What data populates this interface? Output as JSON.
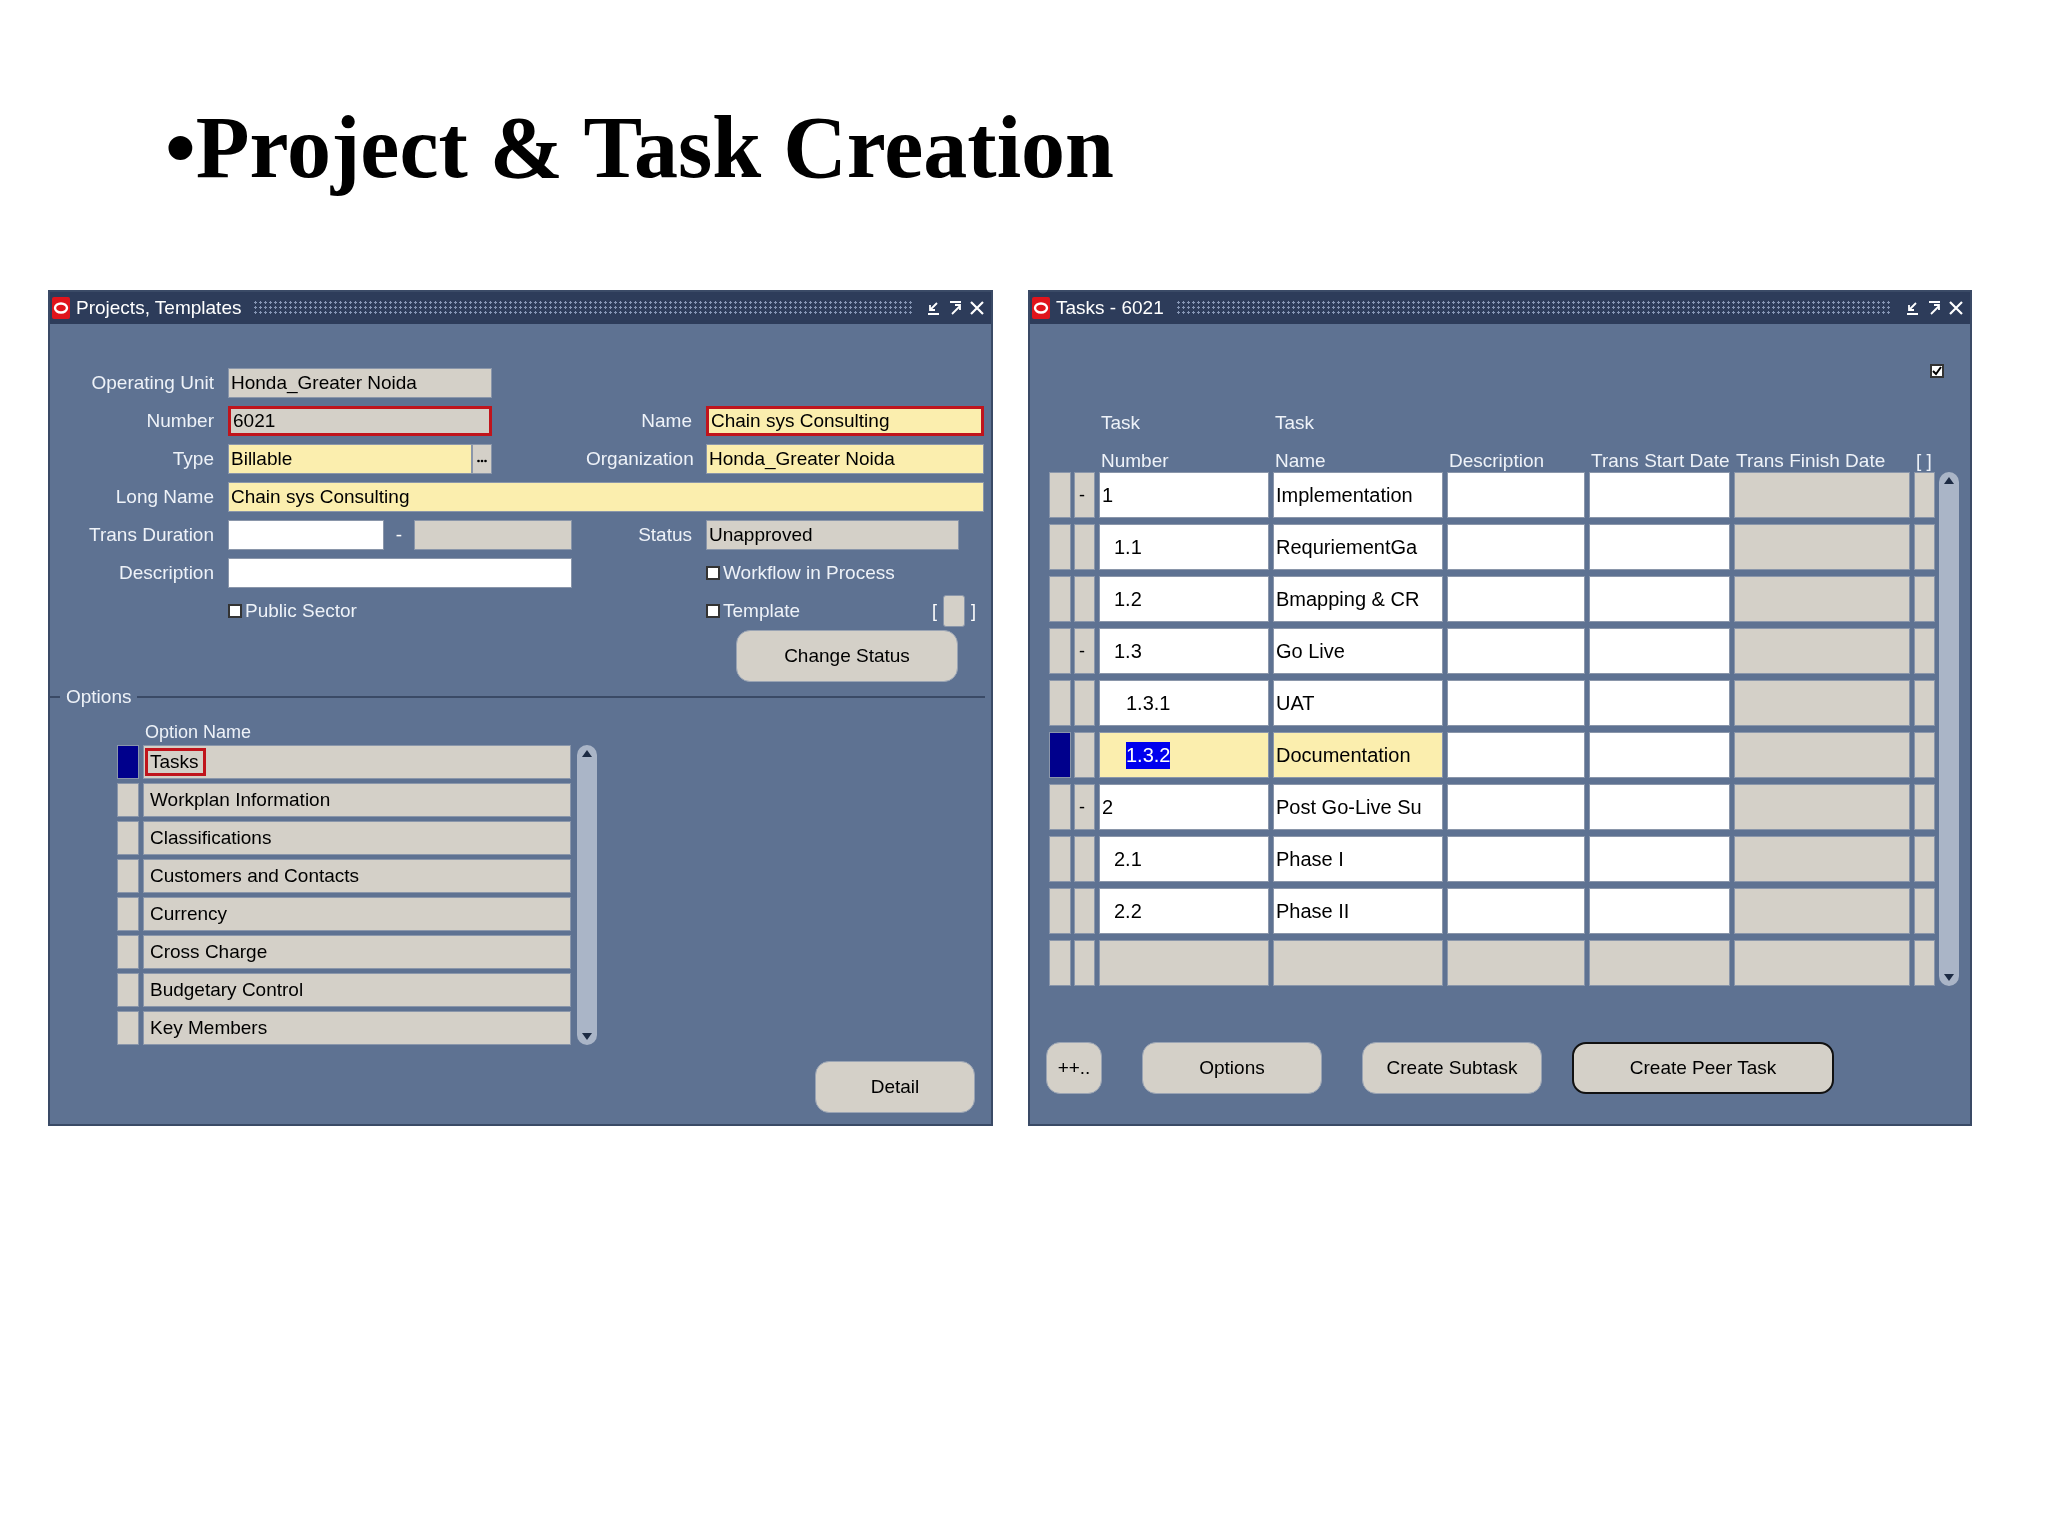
{
  "slide_title": "•Project & Task Creation",
  "projects_window": {
    "title": "Projects, Templates",
    "operating_unit": {
      "label": "Operating Unit",
      "value": "Honda_Greater Noida",
      "kind": "readonly",
      "highlighted": false
    },
    "number": {
      "label": "Number",
      "value": "6021",
      "kind": "readonly",
      "highlighted": true
    },
    "name": {
      "label": "Name",
      "value": "Chain sys Consulting",
      "kind": "required",
      "highlighted": true
    },
    "type": {
      "label": "Type",
      "value": "Billable",
      "kind": "required",
      "highlighted": false
    },
    "organization": {
      "label": "Organization",
      "value": "Honda_Greater Noida",
      "kind": "required",
      "highlighted": false
    },
    "long_name": {
      "label": "Long Name",
      "value": "Chain sys Consulting",
      "kind": "required",
      "highlighted": false
    },
    "trans_duration": {
      "label": "Trans Duration",
      "separator": "-"
    },
    "status": {
      "label": "Status",
      "value": "Unapproved",
      "kind": "readonly",
      "highlighted": false
    },
    "description": {
      "label": "Description"
    },
    "workflow_in_process": {
      "label": "Workflow in Process",
      "checked": false
    },
    "public_sector": {
      "label": "Public Sector",
      "checked": false
    },
    "template": {
      "label": "Template",
      "checked": false
    },
    "context_brackets": [
      "[",
      "]"
    ],
    "change_status_button": "Change Status",
    "options_section": "Options",
    "option_column": "Option Name",
    "options": [
      {
        "label": "Tasks",
        "selected": true,
        "highlighted": true
      },
      {
        "label": "Workplan Information",
        "selected": false,
        "highlighted": false
      },
      {
        "label": "Classifications",
        "selected": false,
        "highlighted": false
      },
      {
        "label": "Customers and Contacts",
        "selected": false,
        "highlighted": false
      },
      {
        "label": "Currency",
        "selected": false,
        "highlighted": false
      },
      {
        "label": "Cross Charge",
        "selected": false,
        "highlighted": false
      },
      {
        "label": "Budgetary Control",
        "selected": false,
        "highlighted": false
      },
      {
        "label": "Key Members",
        "selected": false,
        "highlighted": false
      }
    ],
    "detail_button": "Detail"
  },
  "tasks_window": {
    "title": "Tasks - 6021",
    "header_checkbox": {
      "checked": true
    },
    "columns": [
      {
        "lines": [
          "Task",
          "Number"
        ]
      },
      {
        "lines": [
          "Task",
          "Name"
        ]
      },
      {
        "lines": [
          "Description"
        ]
      },
      {
        "lines": [
          "Trans Start Date"
        ]
      },
      {
        "lines": [
          "Trans Finish Date"
        ]
      },
      {
        "lines": [
          "[ ]"
        ]
      }
    ],
    "tasks": [
      {
        "number": "1",
        "name": "Implementation",
        "expander": "-",
        "selected": false,
        "children": [
          {
            "number": "1.1",
            "name": "RequriementGa",
            "selected": false
          },
          {
            "number": "1.2",
            "name": "Bmapping & CR",
            "selected": false
          },
          {
            "number": "1.3",
            "name": "Go Live",
            "expander": "-",
            "selected": false,
            "children": [
              {
                "number": "1.3.1",
                "name": "UAT",
                "selected": false
              },
              {
                "number": "1.3.2",
                "name": "Documentation",
                "selected": true
              }
            ]
          }
        ]
      },
      {
        "number": "2",
        "name": "Post Go-Live Su",
        "expander": "-",
        "selected": false,
        "children": [
          {
            "number": "2.1",
            "name": "Phase I",
            "selected": false
          },
          {
            "number": "2.2",
            "name": "Phase II",
            "selected": false
          }
        ]
      }
    ],
    "buttons": [
      {
        "label": "++..",
        "kind": "small"
      },
      {
        "label": "Options",
        "kind": "normal"
      },
      {
        "label": "Create Subtask",
        "kind": "normal"
      },
      {
        "label": "Create Peer Task",
        "kind": "default"
      }
    ]
  }
}
